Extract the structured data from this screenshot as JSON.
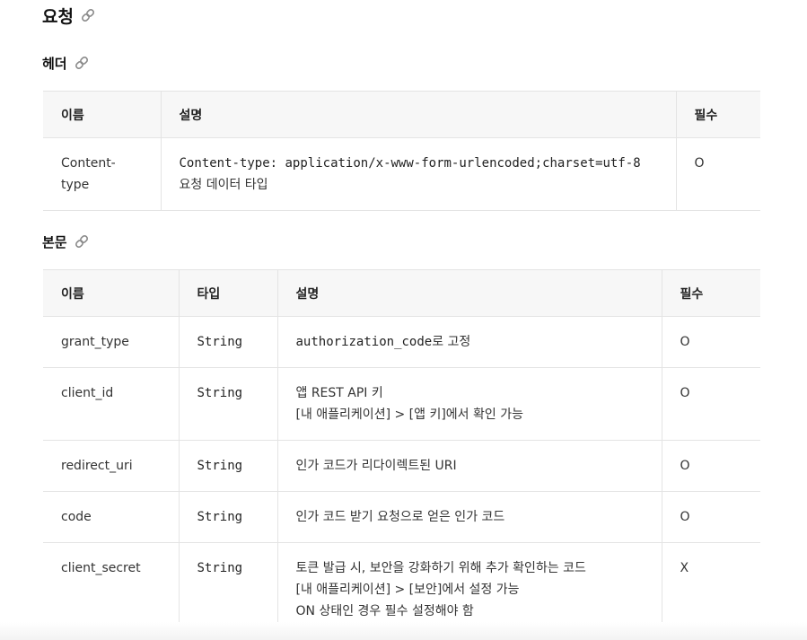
{
  "request": {
    "title": "요청",
    "header_section": {
      "title": "헤더",
      "columns": [
        "이름",
        "설명",
        "필수"
      ],
      "rows": [
        {
          "name": "Content-type",
          "desc_code": "Content-type: application/x-www-form-urlencoded;charset=utf-8",
          "desc_text": "요청 데이터 타입",
          "required": "O"
        }
      ]
    },
    "body_section": {
      "title": "본문",
      "columns": [
        "이름",
        "타입",
        "설명",
        "필수"
      ],
      "rows": [
        {
          "name": "grant_type",
          "type": "String",
          "desc_code": "authorization_code",
          "desc_suffix": "로 고정",
          "required": "O"
        },
        {
          "name": "client_id",
          "type": "String",
          "desc_line1": "앱 REST API 키",
          "desc_line2": "[내 애플리케이션] > [앱 키]에서 확인 가능",
          "required": "O"
        },
        {
          "name": "redirect_uri",
          "type": "String",
          "desc_line1": "인가 코드가 리다이렉트된 URI",
          "required": "O"
        },
        {
          "name": "code",
          "type": "String",
          "desc_line1": "인가 코드 받기 요청으로 얻은 인가 코드",
          "required": "O"
        },
        {
          "name": "client_secret",
          "type": "String",
          "desc_line1": "토큰 발급 시, 보안을 강화하기 위해 추가 확인하는 코드",
          "desc_line2": "[내 애플리케이션] > [보안]에서 설정 가능",
          "desc_line3": "ON 상태인 경우 필수 설정해야 함",
          "required": "X"
        }
      ]
    }
  },
  "icons": {
    "anchor": "link-icon"
  },
  "colors": {
    "header_bg": "#f7f7f7",
    "border": "#e4e4e4",
    "text": "#333333"
  }
}
